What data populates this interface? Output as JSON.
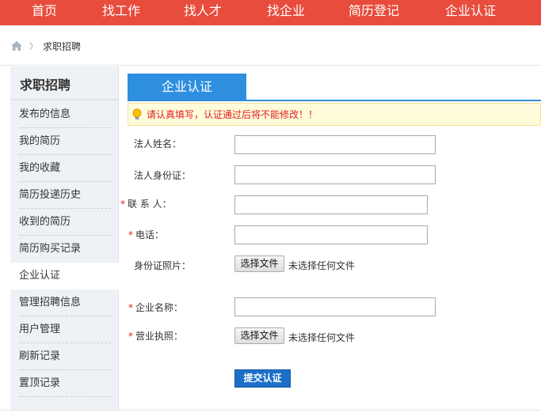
{
  "nav": {
    "items": [
      "首页",
      "找工作",
      "找人才",
      "找企业",
      "简历登记",
      "企业认证"
    ]
  },
  "breadcrumb": {
    "current": "求职招聘",
    "separator": "〉"
  },
  "sidebar": {
    "title": "求职招聘",
    "items": [
      "发布的信息",
      "我的简历",
      "我的收藏",
      "简历投递历史",
      "收到的简历",
      "简历购买记录",
      "企业认证",
      "管理招聘信息",
      "用户管理",
      "刷新记录",
      "置顶记录"
    ],
    "active": "企业认证"
  },
  "main": {
    "tab": "企业认证",
    "notice": "请认真填写，认证通过后将不能修改！！",
    "fields": {
      "legal_name": "法人姓名：",
      "legal_id": "法人身份证：",
      "contact": "联 系 人：",
      "phone": "电话：",
      "id_photo": "身份证照片：",
      "company_name": "企业名称：",
      "license": "营业执照："
    },
    "required_mark": "*",
    "file_button": "选择文件",
    "file_none": "未选择任何文件",
    "submit": "提交认证"
  },
  "colors": {
    "nav_bg": "#e84c3d",
    "tab_bg": "#2e8fe0",
    "required": "#e02020",
    "submit_bg": "#1c6fc9"
  }
}
